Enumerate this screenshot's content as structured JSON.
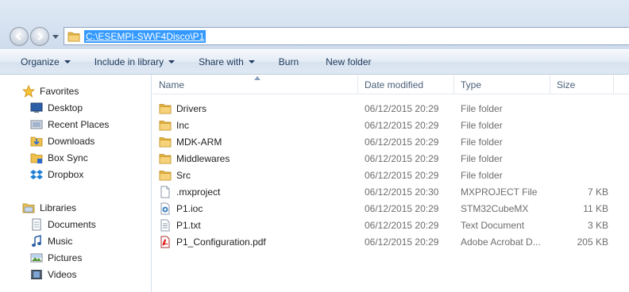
{
  "address": {
    "path": "C:\\ESEMPI-SW\\F4Disco\\P1"
  },
  "toolbar": {
    "organize": "Organize",
    "include_in_library": "Include in library",
    "share_with": "Share with",
    "burn": "Burn",
    "new_folder": "New folder"
  },
  "navigation": {
    "favorites": {
      "label": "Favorites",
      "items": [
        {
          "label": "Desktop",
          "icon": "desktop-icon"
        },
        {
          "label": "Recent Places",
          "icon": "recent-places-icon"
        },
        {
          "label": "Downloads",
          "icon": "downloads-icon"
        },
        {
          "label": "Box Sync",
          "icon": "box-sync-icon"
        },
        {
          "label": "Dropbox",
          "icon": "dropbox-icon"
        }
      ]
    },
    "libraries": {
      "label": "Libraries",
      "items": [
        {
          "label": "Documents",
          "icon": "documents-icon"
        },
        {
          "label": "Music",
          "icon": "music-icon"
        },
        {
          "label": "Pictures",
          "icon": "pictures-icon"
        },
        {
          "label": "Videos",
          "icon": "videos-icon"
        }
      ]
    }
  },
  "columns": {
    "name": "Name",
    "date_modified": "Date modified",
    "type": "Type",
    "size": "Size"
  },
  "files": [
    {
      "name": "Drivers",
      "date": "06/12/2015 20:29",
      "type": "File folder",
      "size": "",
      "icon": "folder-icon"
    },
    {
      "name": "Inc",
      "date": "06/12/2015 20:29",
      "type": "File folder",
      "size": "",
      "icon": "folder-icon"
    },
    {
      "name": "MDK-ARM",
      "date": "06/12/2015 20:29",
      "type": "File folder",
      "size": "",
      "icon": "folder-icon"
    },
    {
      "name": "Middlewares",
      "date": "06/12/2015 20:29",
      "type": "File folder",
      "size": "",
      "icon": "folder-icon"
    },
    {
      "name": "Src",
      "date": "06/12/2015 20:29",
      "type": "File folder",
      "size": "",
      "icon": "folder-icon"
    },
    {
      "name": ".mxproject",
      "date": "06/12/2015 20:30",
      "type": "MXPROJECT File",
      "size": "7 KB",
      "icon": "blank-file-icon"
    },
    {
      "name": "P1.ioc",
      "date": "06/12/2015 20:29",
      "type": "STM32CubeMX",
      "size": "11 KB",
      "icon": "stm32cubemx-file-icon"
    },
    {
      "name": "P1.txt",
      "date": "06/12/2015 20:29",
      "type": "Text Document",
      "size": "3 KB",
      "icon": "text-file-icon"
    },
    {
      "name": "P1_Configuration.pdf",
      "date": "06/12/2015 20:29",
      "type": "Adobe Acrobat D...",
      "size": "205 KB",
      "icon": "pdf-file-icon"
    }
  ]
}
